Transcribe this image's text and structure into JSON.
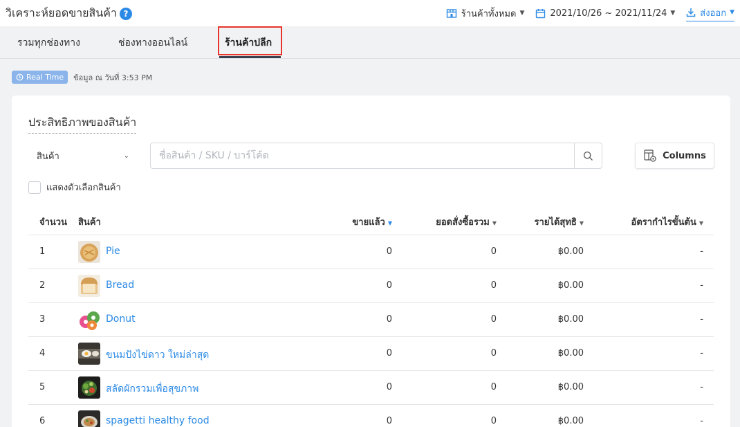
{
  "header": {
    "title": "วิเคราะห์ยอดขายสินค้า",
    "help_icon": "?",
    "store_filter": "ร้านค้าทั้งหมด",
    "date_range": "2021/10/26 ~ 2021/11/24",
    "export_label": "ส่งออก"
  },
  "tabs": [
    {
      "label": "รวมทุกช่องทาง"
    },
    {
      "label": "ช่องทางออนไลน์"
    },
    {
      "label": "ร้านค้าปลีก",
      "active": true
    }
  ],
  "realtime": {
    "badge": "Real Time",
    "note": "ข้อมูล ณ วันที่ 3:53 PM"
  },
  "card": {
    "title": "ประสิทธิภาพของสินค้า",
    "select_value": "สินค้า",
    "search_placeholder": "ชื่อสินค้า / SKU / บาร์โค้ด",
    "columns_label": "Columns",
    "show_options_label": "แสดงตัวเลือกสินค้า"
  },
  "table": {
    "headers": {
      "num": "จำนวน",
      "product": "สินค้า",
      "sold": "ขายแล้ว",
      "order_total": "ยอดสั่งซื้อรวม",
      "net_income": "รายได้สุทธิ",
      "margin": "อัตรากำไรขั้นต้น"
    },
    "rows": [
      {
        "num": "1",
        "name": "Pie",
        "sold": "0",
        "order_total": "0",
        "net_income": "฿0.00",
        "margin": "-"
      },
      {
        "num": "2",
        "name": "Bread",
        "sold": "0",
        "order_total": "0",
        "net_income": "฿0.00",
        "margin": "-"
      },
      {
        "num": "3",
        "name": "Donut",
        "sold": "0",
        "order_total": "0",
        "net_income": "฿0.00",
        "margin": "-"
      },
      {
        "num": "4",
        "name": "ขนมปังไข่ดาว ใหม่ล่าสุด",
        "sold": "0",
        "order_total": "0",
        "net_income": "฿0.00",
        "margin": "-"
      },
      {
        "num": "5",
        "name": "สลัดผักรวมเพื่อสุขภาพ",
        "sold": "0",
        "order_total": "0",
        "net_income": "฿0.00",
        "margin": "-"
      },
      {
        "num": "6",
        "name": "spagetti healthy food",
        "sold": "0",
        "order_total": "0",
        "net_income": "฿0.00",
        "margin": "-"
      }
    ]
  },
  "colors": {
    "accent": "#2b8ae6",
    "highlight": "#e8342b",
    "realtime_badge": "#8ab4ea"
  }
}
